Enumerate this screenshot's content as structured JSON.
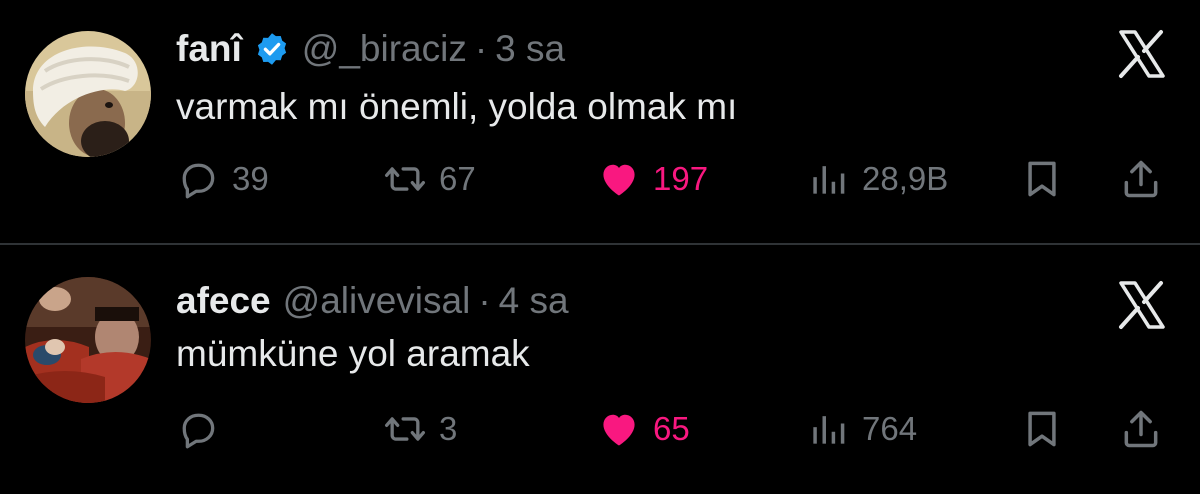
{
  "tweets": [
    {
      "display_name": "fanî",
      "verified": true,
      "handle": "@_biraciz",
      "separator": "·",
      "time": "3 sa",
      "text": "varmak mı önemli, yolda olmak mı",
      "replies": "39",
      "reposts": "67",
      "likes": "197",
      "liked": true,
      "views": "28,9B",
      "avatar": "turban-portrait-avatar"
    },
    {
      "display_name": "afece",
      "verified": false,
      "handle": "@alivevisal",
      "separator": "·",
      "time": "4 sa",
      "text": "mümküne yol aramak",
      "replies": "",
      "reposts": "3",
      "likes": "65",
      "liked": true,
      "views": "764",
      "avatar": "cinema-seats-avatar"
    }
  ],
  "icons": {
    "verified": "verified-badge-icon",
    "platform": "x-logo-icon",
    "reply": "reply-icon",
    "repost": "repost-icon",
    "like": "heart-icon",
    "views": "views-icon",
    "bookmark": "bookmark-icon",
    "share": "share-icon"
  },
  "colors": {
    "background": "#000000",
    "text": "#e7e9ea",
    "muted": "#71767b",
    "like": "#f91880",
    "verified": "#1d9bf0",
    "divider": "#2f3336"
  }
}
